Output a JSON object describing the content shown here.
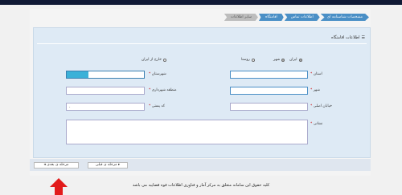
{
  "tabs": [
    "مشخصات شناسنامه ای",
    "اطلاعات تماس",
    "اقامتگاه",
    "سایر اطلاعات"
  ],
  "form_title": "اطلاعات اقامتگاه",
  "residence_options": [
    "ایران",
    "خارج از ایران"
  ],
  "area_options": [
    "شهر",
    "روستا"
  ],
  "fields": {
    "province": "استان",
    "city_county": "شهرستان",
    "city": "شهر",
    "municipal_zone": "منطقه شهرداری",
    "main_street": "خیابان اصلی",
    "postal_code": "کد پستی",
    "address": "نشانی"
  },
  "postal_value": ".",
  "buttons": {
    "prev": "مرحله ی قبلی",
    "next": "مرحله ی بعدی"
  },
  "footer": "کلیه حقوق این سامانه متعلق به مرکز آمار و فناوری اطلاعات قوه قضاییه می باشد"
}
